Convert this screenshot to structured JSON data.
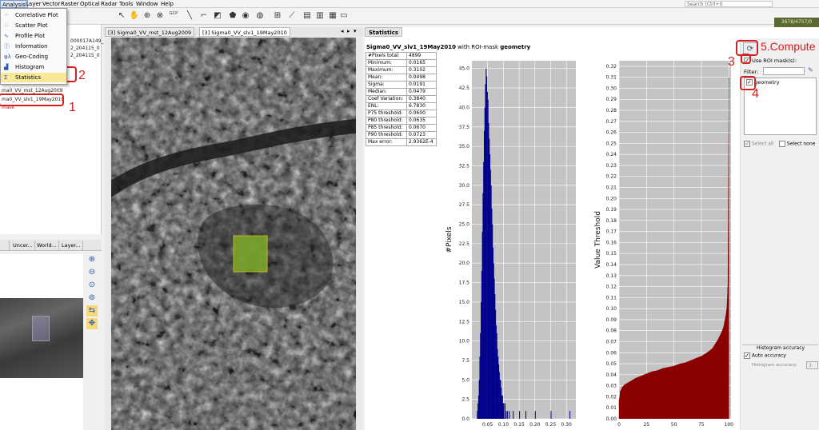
{
  "menu": [
    "Analysis",
    "Layer",
    "Vector",
    "Raster",
    "Optical",
    "Radar",
    "Tools",
    "Window",
    "Help"
  ],
  "search_placeholder": "Search (Ctrl+I)",
  "coord_readout": "3678/4757/0",
  "toolbar": {
    "gcp_label": "GCP"
  },
  "analysis_menu": [
    {
      "label": "Correlative Plot",
      "icon": "scatter-icon"
    },
    {
      "label": "Scatter Plot",
      "icon": "scatter-icon"
    },
    {
      "label": "Profile Plot",
      "icon": "profile-icon"
    },
    {
      "label": "Information",
      "icon": "info-icon"
    },
    {
      "label": "Geo-Coding",
      "icon": "geocoding-icon"
    },
    {
      "label": "Histogram",
      "icon": "histogram-icon"
    },
    {
      "label": "Statistics",
      "icon": "sigma-icon"
    }
  ],
  "product_lines": [
    "000017A149_",
    "2_204115_0",
    "2_204115_0",
    "ma0_VV_mst_12Aug2009",
    "ma0_VV_slv1_19May2010",
    "mask"
  ],
  "left_tabs": [
    "Uncer...",
    "World...",
    "Layer..."
  ],
  "image_tabs": [
    "[3] Sigma0_VV_mst_12Aug2009",
    "[3] Sigma0_VV_slv1_19May2010"
  ],
  "stats": {
    "tab_label": "Statistics",
    "band": "Sigma0_VV_slv1_19May2010",
    "with_text": "with ROI-mask",
    "mask_name": "geometry",
    "rows": [
      [
        "#Pixels total:",
        "4899"
      ],
      [
        "Minimum:",
        "0.0165"
      ],
      [
        "Maximum:",
        "0.3102"
      ],
      [
        "Mean:",
        "0.0498"
      ],
      [
        "Sigma:",
        "0.0191"
      ],
      [
        "Median:",
        "0.0479"
      ],
      [
        "Coef Variation:",
        "0.3840"
      ],
      [
        "ENL:",
        "6.7830"
      ],
      [
        "P75 threshold:",
        "0.0600"
      ],
      [
        "P80 threshold:",
        "0.0635"
      ],
      [
        "P85 threshold:",
        "0.0670"
      ],
      [
        "P90 threshold:",
        "0.0723"
      ],
      [
        "Max error:",
        "2.9362E-4"
      ]
    ],
    "use_roi_label": "Use ROI mask(s):",
    "filter_label": "Filter:",
    "mask_item": "geometry",
    "select_all": "Select all",
    "select_none": "Select none",
    "hist_accuracy_title": "Histogram accuracy",
    "auto_accuracy": "Auto accuracy",
    "accuracy_label": "Histogram accuracy:",
    "accuracy_value": "3"
  },
  "annotations": {
    "a1": "1",
    "a2": "2",
    "a3": "3",
    "a4": "4",
    "a5": "5.Compute"
  },
  "chart_data": [
    {
      "type": "bar",
      "ylabel": "#Pixels",
      "xlabel": "",
      "xlim": [
        0.0,
        0.33
      ],
      "ylim": [
        0,
        46
      ],
      "xticks": [
        "0.05",
        "0.10",
        "0.15",
        "0.20",
        "0.25",
        "0.30"
      ],
      "yticks": [
        "0.0",
        "2.5",
        "5.0",
        "7.5",
        "10.0",
        "12.5",
        "15.0",
        "17.5",
        "20.0",
        "22.5",
        "25.0",
        "27.5",
        "30.0",
        "32.5",
        "35.0",
        "37.5",
        "40.0",
        "42.5",
        "45.0"
      ],
      "color": "#00008b",
      "bins_x": [
        0.016,
        0.018,
        0.02,
        0.022,
        0.024,
        0.026,
        0.028,
        0.03,
        0.032,
        0.034,
        0.036,
        0.038,
        0.04,
        0.042,
        0.044,
        0.046,
        0.048,
        0.05,
        0.052,
        0.054,
        0.056,
        0.058,
        0.06,
        0.062,
        0.064,
        0.066,
        0.068,
        0.07,
        0.072,
        0.074,
        0.076,
        0.078,
        0.08,
        0.082,
        0.084,
        0.086,
        0.088,
        0.09,
        0.092,
        0.094,
        0.096,
        0.098,
        0.1,
        0.104,
        0.108,
        0.112,
        0.118,
        0.13,
        0.15,
        0.17,
        0.2,
        0.25,
        0.31
      ],
      "values": [
        1,
        2,
        3,
        5,
        8,
        11,
        15,
        19,
        24,
        29,
        33,
        37,
        40,
        43,
        45,
        44,
        42,
        41,
        38,
        36,
        34,
        32,
        30,
        27,
        25,
        22,
        20,
        18,
        16,
        14,
        12,
        11,
        9,
        8,
        7,
        6,
        5,
        5,
        4,
        3,
        3,
        2,
        2,
        2,
        1,
        1,
        1,
        1,
        1,
        1,
        1,
        1,
        1
      ]
    },
    {
      "type": "area",
      "ylabel": "Value Threshold",
      "xlabel": "",
      "xlim": [
        0,
        102
      ],
      "ylim": [
        0.0,
        0.325
      ],
      "xticks": [
        "0",
        "25",
        "50",
        "75",
        "100"
      ],
      "yticks": [
        "0.00",
        "0.01",
        "0.02",
        "0.03",
        "0.04",
        "0.05",
        "0.06",
        "0.07",
        "0.08",
        "0.09",
        "0.10",
        "0.11",
        "0.12",
        "0.13",
        "0.14",
        "0.15",
        "0.16",
        "0.17",
        "0.18",
        "0.19",
        "0.20",
        "0.21",
        "0.22",
        "0.23",
        "0.24",
        "0.25",
        "0.26",
        "0.27",
        "0.28",
        "0.29",
        "0.30",
        "0.31",
        "0.32"
      ],
      "color": "#8b0000",
      "x": [
        0,
        1,
        3,
        5,
        10,
        15,
        20,
        25,
        30,
        35,
        40,
        45,
        50,
        55,
        60,
        65,
        70,
        75,
        80,
        85,
        90,
        93,
        95,
        96,
        97,
        98,
        99,
        100
      ],
      "values": [
        0.017,
        0.025,
        0.029,
        0.031,
        0.034,
        0.037,
        0.039,
        0.041,
        0.043,
        0.044,
        0.046,
        0.047,
        0.048,
        0.05,
        0.051,
        0.053,
        0.055,
        0.057,
        0.06,
        0.064,
        0.072,
        0.078,
        0.083,
        0.088,
        0.093,
        0.1,
        0.12,
        0.31
      ]
    }
  ]
}
